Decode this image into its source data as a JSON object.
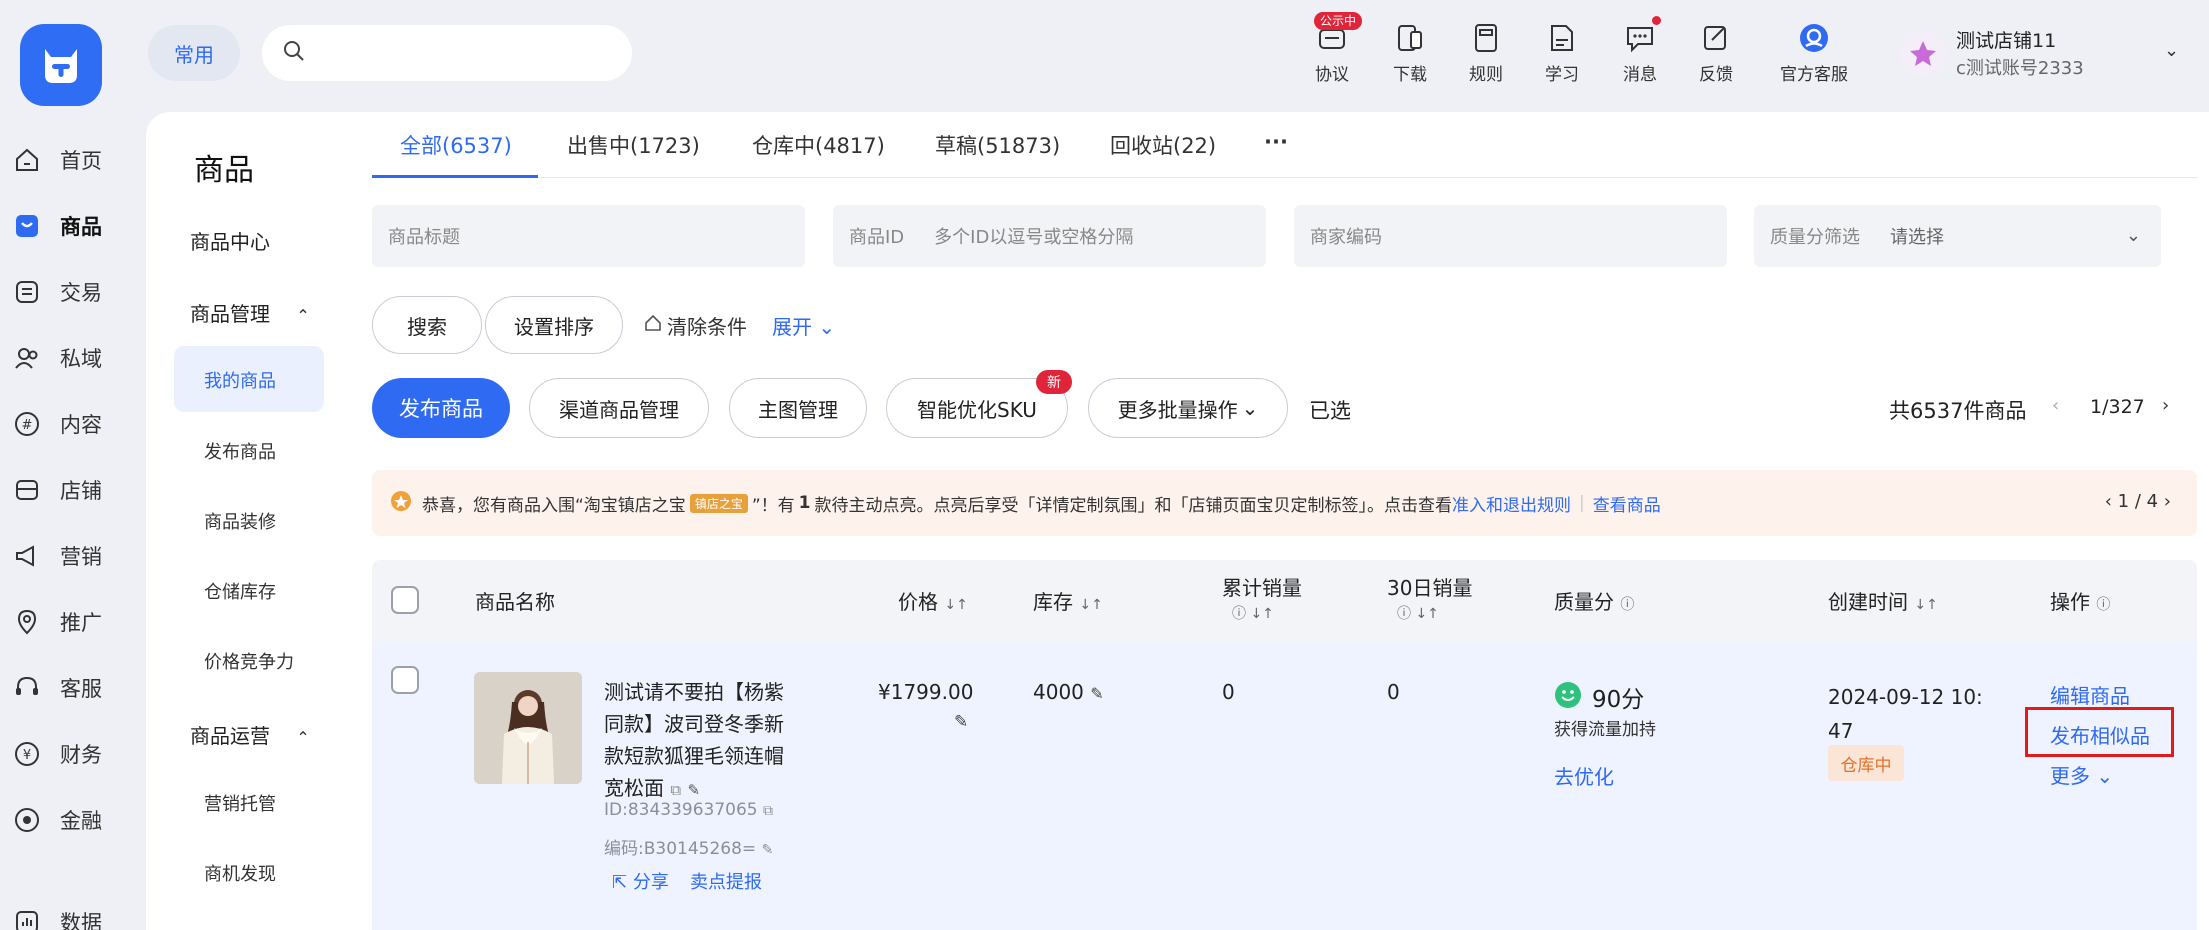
{
  "header": {
    "common_label": "常用",
    "search_placeholder": "",
    "tools": [
      {
        "label": "协议",
        "icon": "protocol-icon",
        "badge": "公示中"
      },
      {
        "label": "下载",
        "icon": "download-icon"
      },
      {
        "label": "规则",
        "icon": "rules-icon"
      },
      {
        "label": "学习",
        "icon": "learn-icon"
      },
      {
        "label": "消息",
        "icon": "message-icon"
      },
      {
        "label": "反馈",
        "icon": "feedback-icon"
      },
      {
        "label": "官方客服",
        "icon": "support-icon"
      }
    ],
    "account": {
      "store_name": "测试店铺11",
      "account_name": "c测试账号2333"
    }
  },
  "rail": [
    {
      "label": "首页",
      "icon": "home-icon"
    },
    {
      "label": "商品",
      "icon": "product-icon",
      "active": true
    },
    {
      "label": "交易",
      "icon": "trade-icon"
    },
    {
      "label": "私域",
      "icon": "private-domain-icon"
    },
    {
      "label": "内容",
      "icon": "content-icon"
    },
    {
      "label": "店铺",
      "icon": "store-icon"
    },
    {
      "label": "营销",
      "icon": "marketing-icon"
    },
    {
      "label": "推广",
      "icon": "promotion-icon"
    },
    {
      "label": "客服",
      "icon": "customer-service-icon"
    },
    {
      "label": "财务",
      "icon": "finance-icon"
    },
    {
      "label": "金融",
      "icon": "loan-icon"
    },
    {
      "label": "数据",
      "icon": "data-icon"
    }
  ],
  "subnav": {
    "title": "商品",
    "center": "商品中心",
    "group1": "商品管理",
    "group1_items": [
      "我的商品",
      "发布商品",
      "商品装修",
      "仓储库存",
      "价格竞争力"
    ],
    "group2": "商品运营",
    "group2_items": [
      "营销托管",
      "商机发现"
    ]
  },
  "tabs": [
    "全部(6537)",
    "出售中(1723)",
    "仓库中(4817)",
    "草稿(51873)",
    "回收站(22)",
    "···"
  ],
  "filters": {
    "title_placeholder": "商品标题",
    "id_label": "商品ID",
    "id_placeholder": "多个ID以逗号或空格分隔",
    "code_placeholder": "商家编码",
    "quality_label": "质量分筛选",
    "quality_value": "请选择"
  },
  "actions": {
    "search": "搜索",
    "sort": "设置排序",
    "clear": "清除条件",
    "expand": "展开",
    "publish": "发布商品",
    "channel": "渠道商品管理",
    "main_image": "主图管理",
    "smart_sku": "智能优化SKU",
    "new_badge": "新",
    "batch": "更多批量操作",
    "selected": "已选",
    "total": "共6537件商品",
    "page": "1/327"
  },
  "notice": {
    "text1": "恭喜，您有商品入围“淘宝镇店之宝",
    "tag": "镇店之宝",
    "text2": "”！有",
    "count": "1",
    "text3": "款待主动点亮。点亮后享受「详情定制氛围」和「店铺页面宝贝定制标签」。点击查看",
    "rules_link": "准入和退出规则",
    "view_link": "查看商品",
    "pager": "1 / 4"
  },
  "table": {
    "headers": {
      "name": "商品名称",
      "price": "价格",
      "stock": "库存",
      "sales_total": "累计销量",
      "sales_30": "30日销量",
      "quality": "质量分",
      "created": "创建时间",
      "ops": "操作"
    },
    "row": {
      "title_l1": "测试请不要拍【杨紫",
      "title_l2": "同款】波司登冬季新",
      "title_l3": "款短款狐狸毛领连帽",
      "title_l4": "宽松面",
      "id": "ID:834339637065",
      "code": "编码:B30145268=",
      "share": "分享",
      "selling_point": "卖点提报",
      "price": "¥1799.00",
      "stock": "4000",
      "sales_total": "0",
      "sales_30": "0",
      "quality_score": "90分",
      "quality_desc": "获得流量加持",
      "optimize": "去优化",
      "created_l1": "2024-09-12 10:",
      "created_l2": "47",
      "status": "仓库中",
      "op_edit": "编辑商品",
      "op_similar": "发布相似品",
      "op_more": "更多"
    }
  },
  "colors": {
    "primary": "#2e6af2",
    "danger": "#e0243a",
    "highlight_border": "#e11b1b"
  }
}
